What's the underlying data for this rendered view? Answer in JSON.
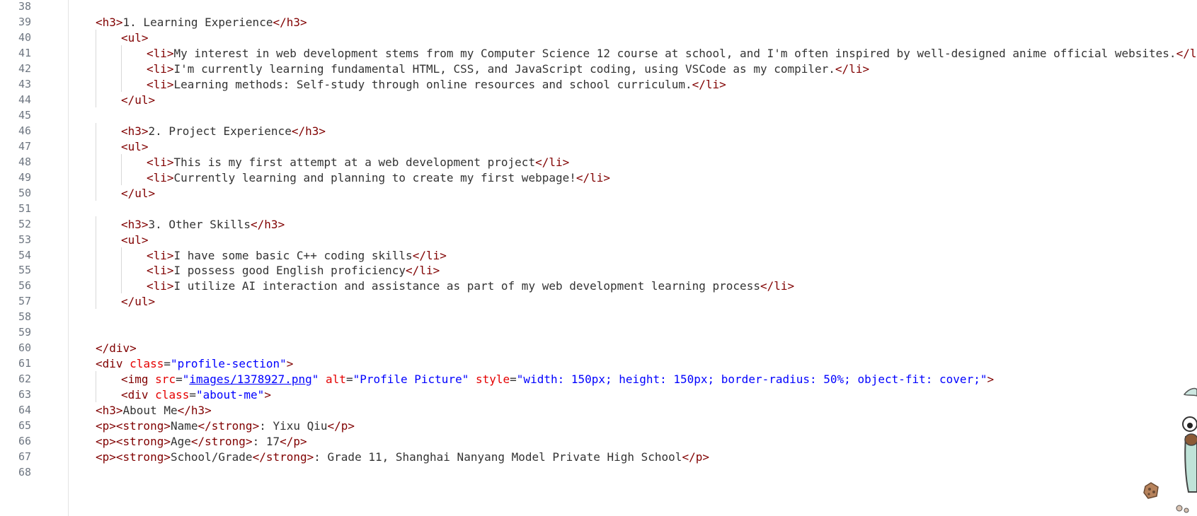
{
  "editor": {
    "lines": [
      {
        "n": "38",
        "indent": 0,
        "tokens": []
      },
      {
        "n": "39",
        "indent": 0,
        "tokens": [
          {
            "t": "tag",
            "v": "<h3>"
          },
          {
            "t": "txt",
            "v": "1. Learning Experience"
          },
          {
            "t": "tag",
            "v": "</h3>"
          }
        ]
      },
      {
        "n": "40",
        "indent": 1,
        "tokens": [
          {
            "t": "tag",
            "v": "<ul>"
          }
        ]
      },
      {
        "n": "41",
        "indent": 2,
        "tokens": [
          {
            "t": "tag",
            "v": "<li>"
          },
          {
            "t": "txt",
            "v": "My interest in web development stems from my Computer Science 12 course at school, and I'm often inspired by well-designed anime official websites."
          },
          {
            "t": "tag",
            "v": "</li>"
          }
        ]
      },
      {
        "n": "42",
        "indent": 2,
        "tokens": [
          {
            "t": "tag",
            "v": "<li>"
          },
          {
            "t": "txt",
            "v": "I'm currently learning fundamental HTML, CSS, and JavaScript coding, using VSCode as my compiler."
          },
          {
            "t": "tag",
            "v": "</li>"
          }
        ]
      },
      {
        "n": "43",
        "indent": 2,
        "tokens": [
          {
            "t": "tag",
            "v": "<li>"
          },
          {
            "t": "txt",
            "v": "Learning methods: Self-study through online resources and school curriculum."
          },
          {
            "t": "tag",
            "v": "</li>"
          }
        ]
      },
      {
        "n": "44",
        "indent": 1,
        "tokens": [
          {
            "t": "tag",
            "v": "</ul>"
          }
        ]
      },
      {
        "n": "45",
        "indent": 0,
        "tokens": []
      },
      {
        "n": "46",
        "indent": 1,
        "tokens": [
          {
            "t": "tag",
            "v": "<h3>"
          },
          {
            "t": "txt",
            "v": "2. Project Experience"
          },
          {
            "t": "tag",
            "v": "</h3>"
          }
        ]
      },
      {
        "n": "47",
        "indent": 1,
        "tokens": [
          {
            "t": "tag",
            "v": "<ul>"
          }
        ]
      },
      {
        "n": "48",
        "indent": 2,
        "tokens": [
          {
            "t": "tag",
            "v": "<li>"
          },
          {
            "t": "txt",
            "v": "This is my first attempt at a web development project"
          },
          {
            "t": "tag",
            "v": "</li>"
          }
        ]
      },
      {
        "n": "49",
        "indent": 2,
        "tokens": [
          {
            "t": "tag",
            "v": "<li>"
          },
          {
            "t": "txt",
            "v": "Currently learning and planning to create my first webpage!"
          },
          {
            "t": "tag",
            "v": "</li>"
          }
        ]
      },
      {
        "n": "50",
        "indent": 1,
        "tokens": [
          {
            "t": "tag",
            "v": "</ul>"
          }
        ]
      },
      {
        "n": "51",
        "indent": 0,
        "tokens": []
      },
      {
        "n": "52",
        "indent": 1,
        "tokens": [
          {
            "t": "tag",
            "v": "<h3>"
          },
          {
            "t": "txt",
            "v": "3. Other Skills"
          },
          {
            "t": "tag",
            "v": "</h3>"
          }
        ]
      },
      {
        "n": "53",
        "indent": 1,
        "tokens": [
          {
            "t": "tag",
            "v": "<ul>"
          }
        ]
      },
      {
        "n": "54",
        "indent": 2,
        "tokens": [
          {
            "t": "tag",
            "v": "<li>"
          },
          {
            "t": "txt",
            "v": "I have some basic C++ coding skills"
          },
          {
            "t": "tag",
            "v": "</li>"
          }
        ]
      },
      {
        "n": "55",
        "indent": 2,
        "tokens": [
          {
            "t": "tag",
            "v": "<li>"
          },
          {
            "t": "txt",
            "v": "I possess good English proficiency"
          },
          {
            "t": "tag",
            "v": "</li>"
          }
        ]
      },
      {
        "n": "56",
        "indent": 2,
        "tokens": [
          {
            "t": "tag",
            "v": "<li>"
          },
          {
            "t": "txt",
            "v": "I utilize AI interaction and assistance as part of my web development learning process"
          },
          {
            "t": "tag",
            "v": "</li>"
          }
        ]
      },
      {
        "n": "57",
        "indent": 1,
        "tokens": [
          {
            "t": "tag",
            "v": "</ul>"
          }
        ]
      },
      {
        "n": "58",
        "indent": 0,
        "tokens": []
      },
      {
        "n": "59",
        "indent": 0,
        "tokens": []
      },
      {
        "n": "60",
        "indent": 0,
        "tokens": [
          {
            "t": "tag",
            "v": "</div>"
          }
        ]
      },
      {
        "n": "61",
        "indent": 0,
        "tokens": [
          {
            "t": "tag",
            "v": "<div "
          },
          {
            "t": "attr",
            "v": "class"
          },
          {
            "t": "txt",
            "v": "="
          },
          {
            "t": "str",
            "v": "\"profile-section\""
          },
          {
            "t": "tag",
            "v": ">"
          }
        ]
      },
      {
        "n": "62",
        "indent": 1,
        "tokens": [
          {
            "t": "tag",
            "v": "<img "
          },
          {
            "t": "attr",
            "v": "src"
          },
          {
            "t": "txt",
            "v": "="
          },
          {
            "t": "str",
            "v": "\""
          },
          {
            "t": "url",
            "v": "images/1378927.png"
          },
          {
            "t": "str",
            "v": "\""
          },
          {
            "t": "txt",
            "v": " "
          },
          {
            "t": "attr",
            "v": "alt"
          },
          {
            "t": "txt",
            "v": "="
          },
          {
            "t": "str",
            "v": "\"Profile Picture\""
          },
          {
            "t": "txt",
            "v": " "
          },
          {
            "t": "attr",
            "v": "style"
          },
          {
            "t": "txt",
            "v": "="
          },
          {
            "t": "str",
            "v": "\"width: 150px; height: 150px; border-radius: 50%; object-fit: cover;\""
          },
          {
            "t": "tag",
            "v": ">"
          }
        ]
      },
      {
        "n": "63",
        "indent": 1,
        "tokens": [
          {
            "t": "tag",
            "v": "<div "
          },
          {
            "t": "attr",
            "v": "class"
          },
          {
            "t": "txt",
            "v": "="
          },
          {
            "t": "str",
            "v": "\"about-me\""
          },
          {
            "t": "tag",
            "v": ">"
          }
        ]
      },
      {
        "n": "64",
        "indent": 0,
        "tokens": [
          {
            "t": "tag",
            "v": "<h3>"
          },
          {
            "t": "txt",
            "v": "About Me"
          },
          {
            "t": "tag",
            "v": "</h3>"
          }
        ]
      },
      {
        "n": "65",
        "indent": 0,
        "tokens": [
          {
            "t": "tag",
            "v": "<p><strong>"
          },
          {
            "t": "txt",
            "v": "Name"
          },
          {
            "t": "tag",
            "v": "</strong>"
          },
          {
            "t": "txt",
            "v": ": Yixu Qiu"
          },
          {
            "t": "tag",
            "v": "</p>"
          }
        ]
      },
      {
        "n": "66",
        "indent": 0,
        "tokens": [
          {
            "t": "tag",
            "v": "<p><strong>"
          },
          {
            "t": "txt",
            "v": "Age"
          },
          {
            "t": "tag",
            "v": "</strong>"
          },
          {
            "t": "txt",
            "v": ": 17"
          },
          {
            "t": "tag",
            "v": "</p>"
          }
        ]
      },
      {
        "n": "67",
        "indent": 0,
        "tokens": [
          {
            "t": "tag",
            "v": "<p><strong>"
          },
          {
            "t": "txt",
            "v": "School/Grade"
          },
          {
            "t": "tag",
            "v": "</strong>"
          },
          {
            "t": "txt",
            "v": ": Grade 11, Shanghai Nanyang Model Private High School"
          },
          {
            "t": "tag",
            "v": "</p>"
          }
        ]
      },
      {
        "n": "68",
        "indent": 0,
        "tokens": []
      }
    ]
  },
  "colors": {
    "tag": "#800000",
    "attribute": "#e50000",
    "string": "#0000ff",
    "text": "#333333",
    "line_number": "#6e7681"
  },
  "decorations": {
    "mascot": "cartoon-mascot-figure",
    "cookie": "cookie-icon"
  }
}
